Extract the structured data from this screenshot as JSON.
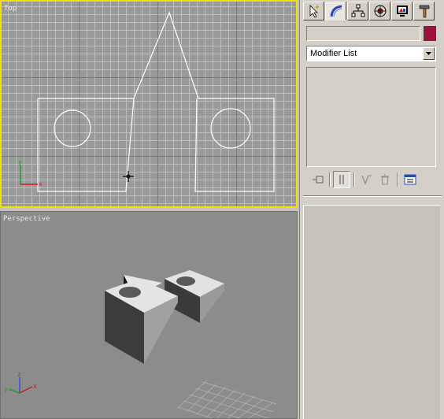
{
  "viewports": {
    "top": {
      "label": "Top",
      "active": true
    },
    "perspective": {
      "label": "Perspective",
      "active": false
    }
  },
  "axes": {
    "x": "x",
    "y": "y",
    "z": "z"
  },
  "panel": {
    "tabs": [
      {
        "name": "create-tab",
        "icon": "cursor-arrow-icon"
      },
      {
        "name": "modify-tab",
        "icon": "modify-arc-icon"
      },
      {
        "name": "hierarchy-tab",
        "icon": "hierarchy-icon"
      },
      {
        "name": "motion-tab",
        "icon": "motion-wheel-icon"
      },
      {
        "name": "display-tab",
        "icon": "display-monitor-icon"
      },
      {
        "name": "utilities-tab",
        "icon": "hammer-icon"
      }
    ],
    "active_tab": "modify-tab",
    "object_name": "",
    "object_color": "#a0103c",
    "modifier_list_label": "Modifier List"
  },
  "colors": {
    "active_viewport_border": "#f0e400",
    "shape_lines": "#ffffff"
  }
}
